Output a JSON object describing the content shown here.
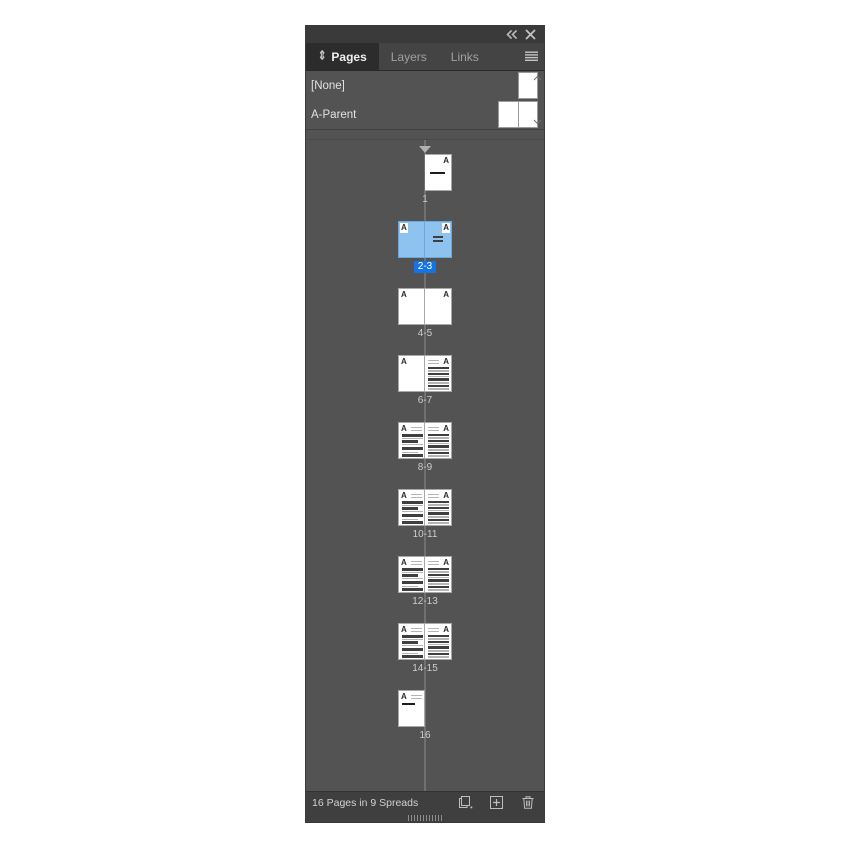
{
  "panel": {
    "titlebar": {
      "collapse_icon": "double-chevron-left-icon",
      "close_icon": "close-icon"
    },
    "tabs": [
      {
        "label": "Pages",
        "active": true
      },
      {
        "label": "Layers",
        "active": false
      },
      {
        "label": "Links",
        "active": false
      }
    ],
    "menu_icon": "hamburger-menu-icon",
    "parents": {
      "items": [
        {
          "label": "[None]",
          "type": "single"
        },
        {
          "label": "A-Parent",
          "type": "spread"
        }
      ]
    },
    "spreads": [
      {
        "label": "1",
        "selected": false,
        "section_marker": true,
        "pages": [
          {
            "side": "right",
            "parent_mark": "A",
            "mark_pos": "tr",
            "content": "title-rule"
          }
        ]
      },
      {
        "label": "2-3",
        "selected": true,
        "section_marker": false,
        "pages": [
          {
            "side": "left",
            "parent_mark": "A",
            "mark_pos": "tl",
            "content": "blank"
          },
          {
            "side": "right",
            "parent_mark": "A",
            "mark_pos": "tr",
            "content": "equals"
          }
        ]
      },
      {
        "label": "4-5",
        "selected": false,
        "section_marker": false,
        "pages": [
          {
            "side": "left",
            "parent_mark": "A",
            "mark_pos": "tl",
            "content": "blank"
          },
          {
            "side": "right",
            "parent_mark": "A",
            "mark_pos": "tr",
            "content": "blank"
          }
        ]
      },
      {
        "label": "6-7",
        "selected": false,
        "section_marker": false,
        "pages": [
          {
            "side": "left",
            "parent_mark": "A",
            "mark_pos": "tl",
            "content": "blank"
          },
          {
            "side": "right",
            "parent_mark": "A",
            "mark_pos": "tr",
            "content": "text-full"
          }
        ]
      },
      {
        "label": "8-9",
        "selected": false,
        "section_marker": false,
        "pages": [
          {
            "side": "left",
            "parent_mark": "A",
            "mark_pos": "tl",
            "content": "text-head"
          },
          {
            "side": "right",
            "parent_mark": "A",
            "mark_pos": "tr",
            "content": "text-full"
          }
        ]
      },
      {
        "label": "10-11",
        "selected": false,
        "section_marker": false,
        "pages": [
          {
            "side": "left",
            "parent_mark": "A",
            "mark_pos": "tl",
            "content": "text-head"
          },
          {
            "side": "right",
            "parent_mark": "A",
            "mark_pos": "tr",
            "content": "text-full"
          }
        ]
      },
      {
        "label": "12-13",
        "selected": false,
        "section_marker": false,
        "pages": [
          {
            "side": "left",
            "parent_mark": "A",
            "mark_pos": "tl",
            "content": "text-head"
          },
          {
            "side": "right",
            "parent_mark": "A",
            "mark_pos": "tr",
            "content": "text-full"
          }
        ]
      },
      {
        "label": "14-15",
        "selected": false,
        "section_marker": false,
        "pages": [
          {
            "side": "left",
            "parent_mark": "A",
            "mark_pos": "tl",
            "content": "text-head"
          },
          {
            "side": "right",
            "parent_mark": "A",
            "mark_pos": "tr",
            "content": "text-full"
          }
        ]
      },
      {
        "label": "16",
        "selected": false,
        "section_marker": false,
        "pages": [
          {
            "side": "left",
            "parent_mark": "A",
            "mark_pos": "tl",
            "content": "text-top"
          }
        ]
      }
    ],
    "footer": {
      "status": "16 Pages in 9 Spreads",
      "icons": [
        {
          "name": "edit-page-size-icon"
        },
        {
          "name": "new-page-icon"
        },
        {
          "name": "delete-page-icon"
        }
      ]
    },
    "colors": {
      "panel_bg": "#535353",
      "tab_active_bg": "#2c2c2c",
      "tab_inactive_bg": "#444444",
      "titlebar_bg": "#3a3a3a",
      "footer_bg": "#3f3f3f",
      "selection_fill": "#8ec3ef",
      "selection_badge": "#1473e6",
      "page_white": "#ffffff"
    }
  }
}
